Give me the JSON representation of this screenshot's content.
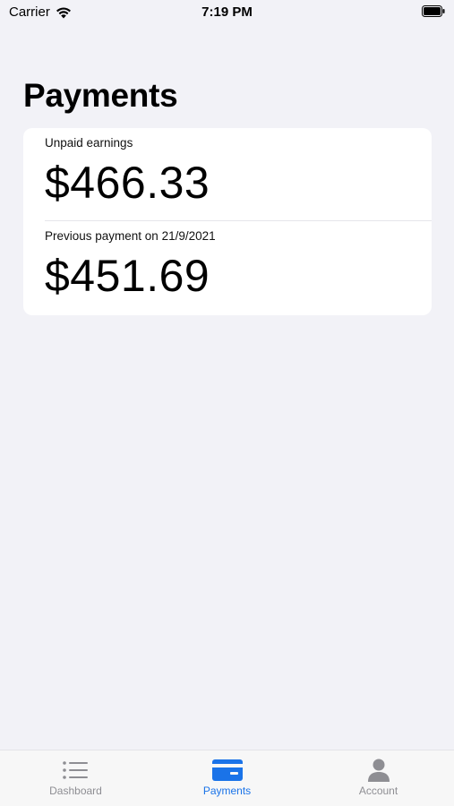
{
  "status_bar": {
    "carrier": "Carrier",
    "time": "7:19 PM"
  },
  "page": {
    "title": "Payments"
  },
  "card": {
    "unpaid_label": "Unpaid earnings",
    "unpaid_amount": "$466.33",
    "previous_label": "Previous payment on 21/9/2021",
    "previous_amount": "$451.69"
  },
  "tab_bar": {
    "tabs": [
      {
        "label": "Dashboard",
        "icon": "list-icon",
        "active": false
      },
      {
        "label": "Payments",
        "icon": "credit-card-icon",
        "active": true
      },
      {
        "label": "Account",
        "icon": "person-icon",
        "active": false
      }
    ]
  },
  "colors": {
    "accent": "#1a73e8",
    "inactive": "#8e8e93",
    "background": "#f2f2f7"
  }
}
